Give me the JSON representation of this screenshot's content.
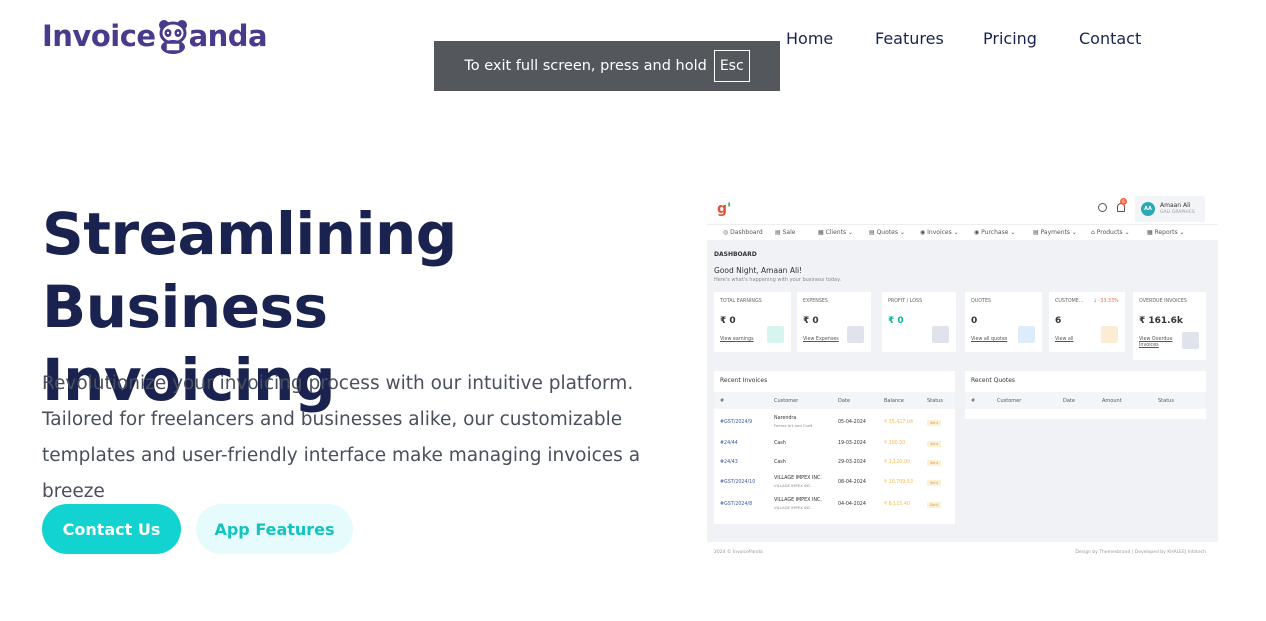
{
  "header": {
    "logo_text_left": "Invoice",
    "logo_text_right": "anda",
    "nav": [
      "Home",
      "Features",
      "Pricing",
      "Contact"
    ]
  },
  "fullscreen_toast": {
    "text": "To exit full screen, press and hold",
    "key": "Esc"
  },
  "hero": {
    "title_line1": "Streamlining Business",
    "title_line2": "Invoicing",
    "desc_line1": "Revolutionize your invoicing process with our intuitive platform.",
    "desc_line2": "Tailored for freelancers and businesses alike, our customizable",
    "desc_line3": "templates and user-friendly interface make managing invoices a breeze",
    "primary_button": "Contact Us",
    "secondary_button": "App Features"
  },
  "dashboard": {
    "user_name": "Amaan Ali",
    "user_company": "GALI GRAPHICS",
    "user_initials": "AA",
    "notification_count": "6",
    "menu": [
      "Dashboard",
      "Sale",
      "Clients",
      "Quotes",
      "Invoices",
      "Purchase",
      "Payments",
      "Products",
      "Reports"
    ],
    "heading": "DASHBOARD",
    "greeting": "Good Night, Amaan Ali!",
    "subtitle": "Here's what's happening with your business today.",
    "cards": [
      {
        "label": "TOTAL EARNINGS",
        "value": "₹ 0",
        "link": "View earnings",
        "icon": "dollar-icon",
        "color": "#d6f5ef"
      },
      {
        "label": "EXPENSES",
        "value": "₹ 0",
        "link": "View Expenses",
        "icon": "wallet-icon",
        "color": "#e0e3ec"
      },
      {
        "label": "PROFIT / LOSS",
        "value": "₹ 0",
        "link": "",
        "icon": "wallet-icon",
        "color": "#e0e3ec"
      },
      {
        "label": "QUOTES",
        "value": "0",
        "link": "View all quotes",
        "icon": "bag-icon",
        "color": "#dcecfb"
      },
      {
        "label": "CUSTOME...",
        "pct": "↓ -33.33%",
        "value": "6",
        "link": "View all",
        "icon": "user-icon",
        "color": "#fdecd4"
      },
      {
        "label": "OVERDUE INVOICES",
        "value": "₹ 161.6k",
        "link": "View Overdue Invoices",
        "icon": "wallet-icon",
        "color": "#e0e3ec"
      }
    ],
    "recent_invoices": {
      "title": "Recent Invoices",
      "columns": [
        "#",
        "Customer",
        "Date",
        "Balance",
        "Status"
      ],
      "rows": [
        {
          "id": "#GST/2024/9",
          "customer": "Narendra",
          "customer_sub": "Feeroz Art and Craft",
          "date": "05-04-2024",
          "balance": "₹ 35,427.04",
          "status": "Sent"
        },
        {
          "id": "#24/44",
          "customer": "Cash",
          "customer_sub": "",
          "date": "19-03-2024",
          "balance": "₹ 300.00",
          "status": "Sent"
        },
        {
          "id": "#24/43",
          "customer": "Cash",
          "customer_sub": "",
          "date": "29-03-2024",
          "balance": "₹ 1,120.00",
          "status": "Sent"
        },
        {
          "id": "#GST/2024/10",
          "customer": "VILLAGE IMPEX INC.",
          "customer_sub": "VILLAGE IMPEX INC.",
          "date": "08-04-2024",
          "balance": "₹ 10,709.53",
          "status": "Sent"
        },
        {
          "id": "#GST/2024/8",
          "customer": "VILLAGE IMPEX INC.",
          "customer_sub": "VILLAGE IMPEX INC.",
          "date": "04-04-2024",
          "balance": "₹ 8,115.40",
          "status": "Sent"
        }
      ]
    },
    "recent_quotes": {
      "title": "Recent Quotes",
      "columns": [
        "#",
        "Customer",
        "Date",
        "Amount",
        "Status"
      ]
    },
    "footer_left": "2024 © InvoicePanda.",
    "footer_right": "Design by Themesbrand | Developed by KHALEEJ Infotech"
  }
}
